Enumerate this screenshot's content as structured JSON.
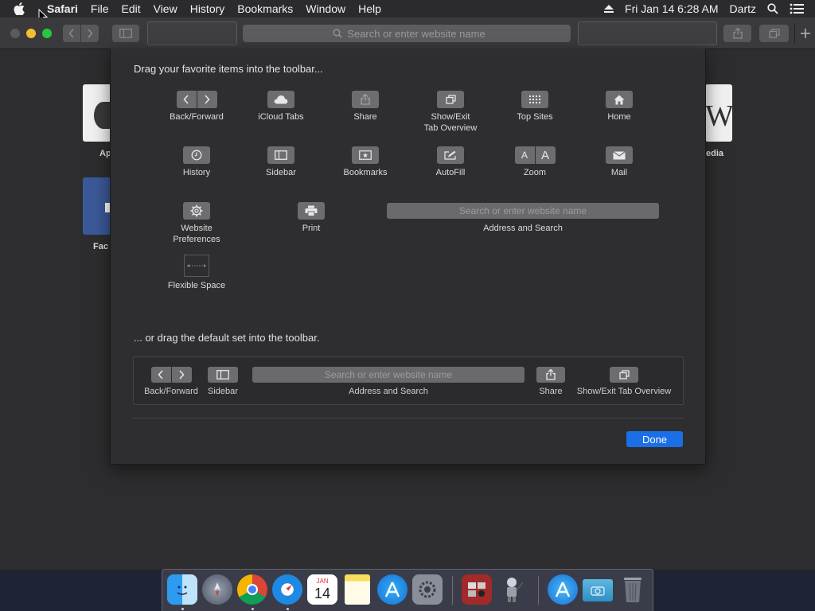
{
  "menubar": {
    "items": [
      "Safari",
      "File",
      "Edit",
      "View",
      "History",
      "Bookmarks",
      "Window",
      "Help"
    ],
    "clock": "Fri Jan 14  6:28 AM",
    "user": "Dartz"
  },
  "toolbar": {
    "address_placeholder": "Search or enter website name"
  },
  "favorites": {
    "tile_labels": [
      "Ap",
      "edia",
      "Fac"
    ]
  },
  "sheet": {
    "heading_top": "Drag your favorite items into the toolbar...",
    "heading_bottom": "... or drag the default set into the toolbar.",
    "items": {
      "back_forward": "Back/Forward",
      "icloud_tabs": "iCloud Tabs",
      "share": "Share",
      "tab_overview_1": "Show/Exit",
      "tab_overview_2": "Tab Overview",
      "top_sites": "Top Sites",
      "home": "Home",
      "history": "History",
      "sidebar": "Sidebar",
      "bookmarks": "Bookmarks",
      "autofill": "AutoFill",
      "zoom": "Zoom",
      "mail": "Mail",
      "website_prefs_1": "Website",
      "website_prefs_2": "Preferences",
      "print": "Print",
      "address_and_search": "Address and Search",
      "flexible_space": "Flexible Space"
    },
    "address_placeholder": "Search or enter website name",
    "zoom_glyphs": [
      "A",
      "A"
    ],
    "default_set": {
      "back_forward": "Back/Forward",
      "sidebar": "Sidebar",
      "address_and_search": "Address and Search",
      "share": "Share",
      "tab_overview": "Show/Exit Tab Overview",
      "address_placeholder": "Search or enter website name"
    },
    "done_label": "Done"
  },
  "dock": {
    "calendar_month": "JAN",
    "calendar_day": "14",
    "apps": [
      "finder",
      "launchpad",
      "chrome",
      "safari",
      "calendar",
      "notes",
      "app-store",
      "system-preferences",
      "photo-booth",
      "automator",
      "app-store-folder",
      "documents-folder",
      "trash"
    ]
  }
}
